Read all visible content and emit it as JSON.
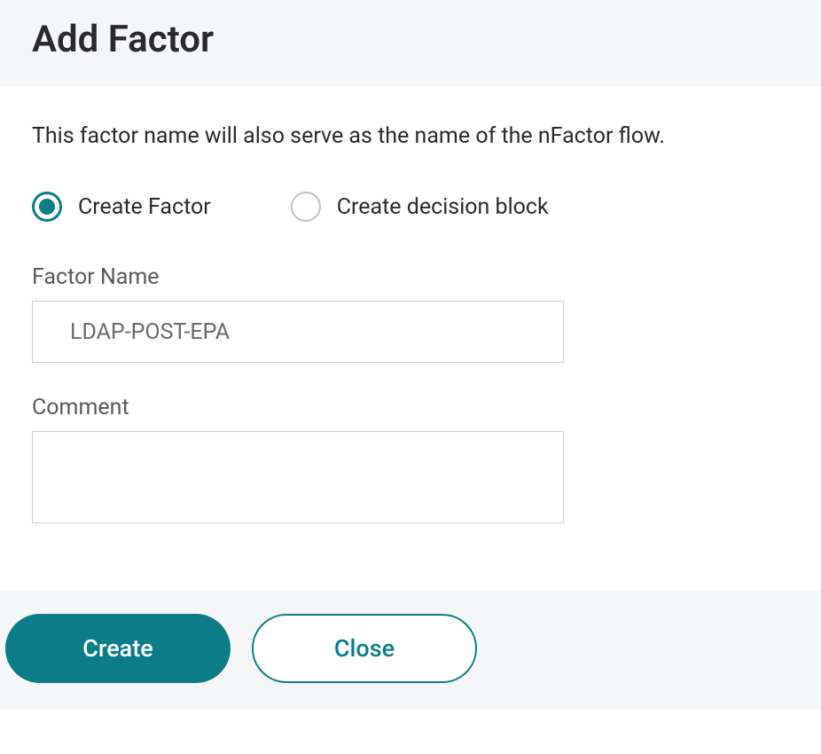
{
  "header": {
    "title": "Add Factor"
  },
  "content": {
    "description": "This factor name will also serve as the name of the nFactor flow.",
    "radio": {
      "create_factor": "Create Factor",
      "create_decision_block": "Create decision block"
    },
    "fields": {
      "factor_name_label": "Factor Name",
      "factor_name_value": "LDAP-POST-EPA",
      "comment_label": "Comment",
      "comment_value": ""
    }
  },
  "footer": {
    "create_label": "Create",
    "close_label": "Close"
  }
}
